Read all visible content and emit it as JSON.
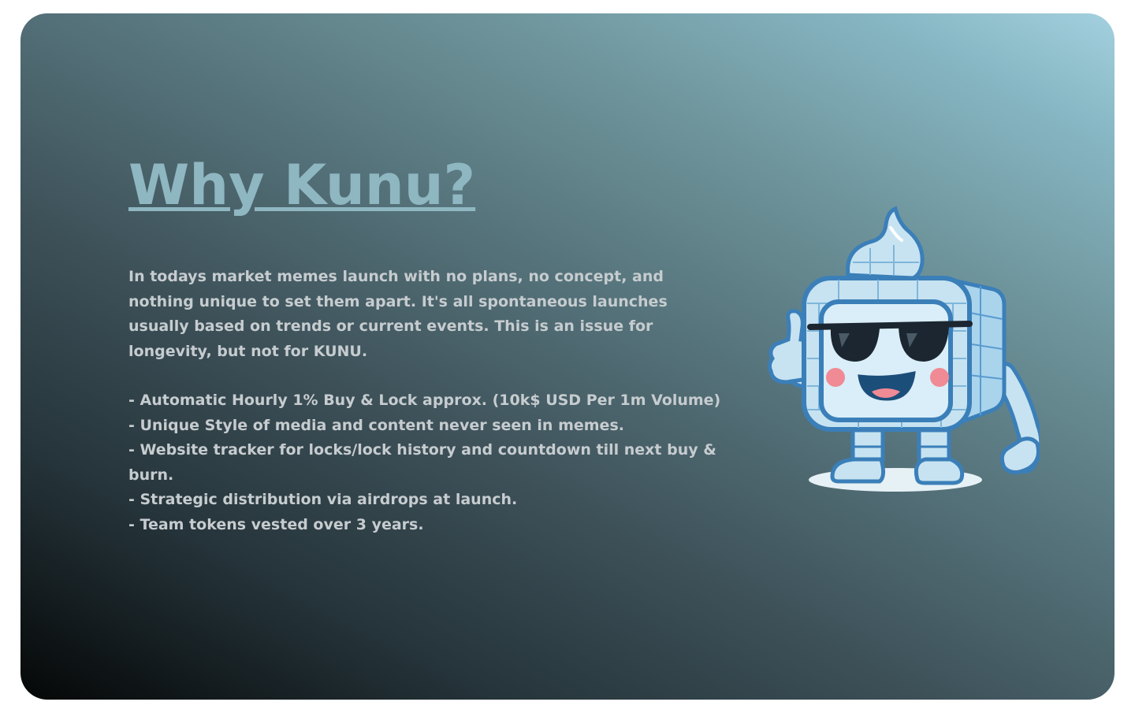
{
  "section": {
    "title": "Why Kunu?",
    "intro": "In todays market memes launch with no plans, no concept, and nothing unique to set them apart. It's all spontaneous launches usually based on trends or current events. This is an issue for longevity, but not for KUNU.",
    "features": [
      "- Automatic Hourly 1% Buy & Lock approx. (10k$ USD Per 1m Volume)",
      "- Unique Style of media and content never seen in memes.",
      "- Website tracker for locks/lock history and countdown till next buy & burn.",
      "- Strategic distribution via airdrops at launch.",
      "- Team tokens vested over 3 years."
    ]
  },
  "mascot": {
    "icon": "ice-cube-mascot-sunglasses-thumbs-up"
  },
  "colors": {
    "title": "#8fb7c2",
    "body_text": "#c6cccf",
    "gradient_light": "#a3d0de",
    "gradient_dark": "#050707"
  }
}
